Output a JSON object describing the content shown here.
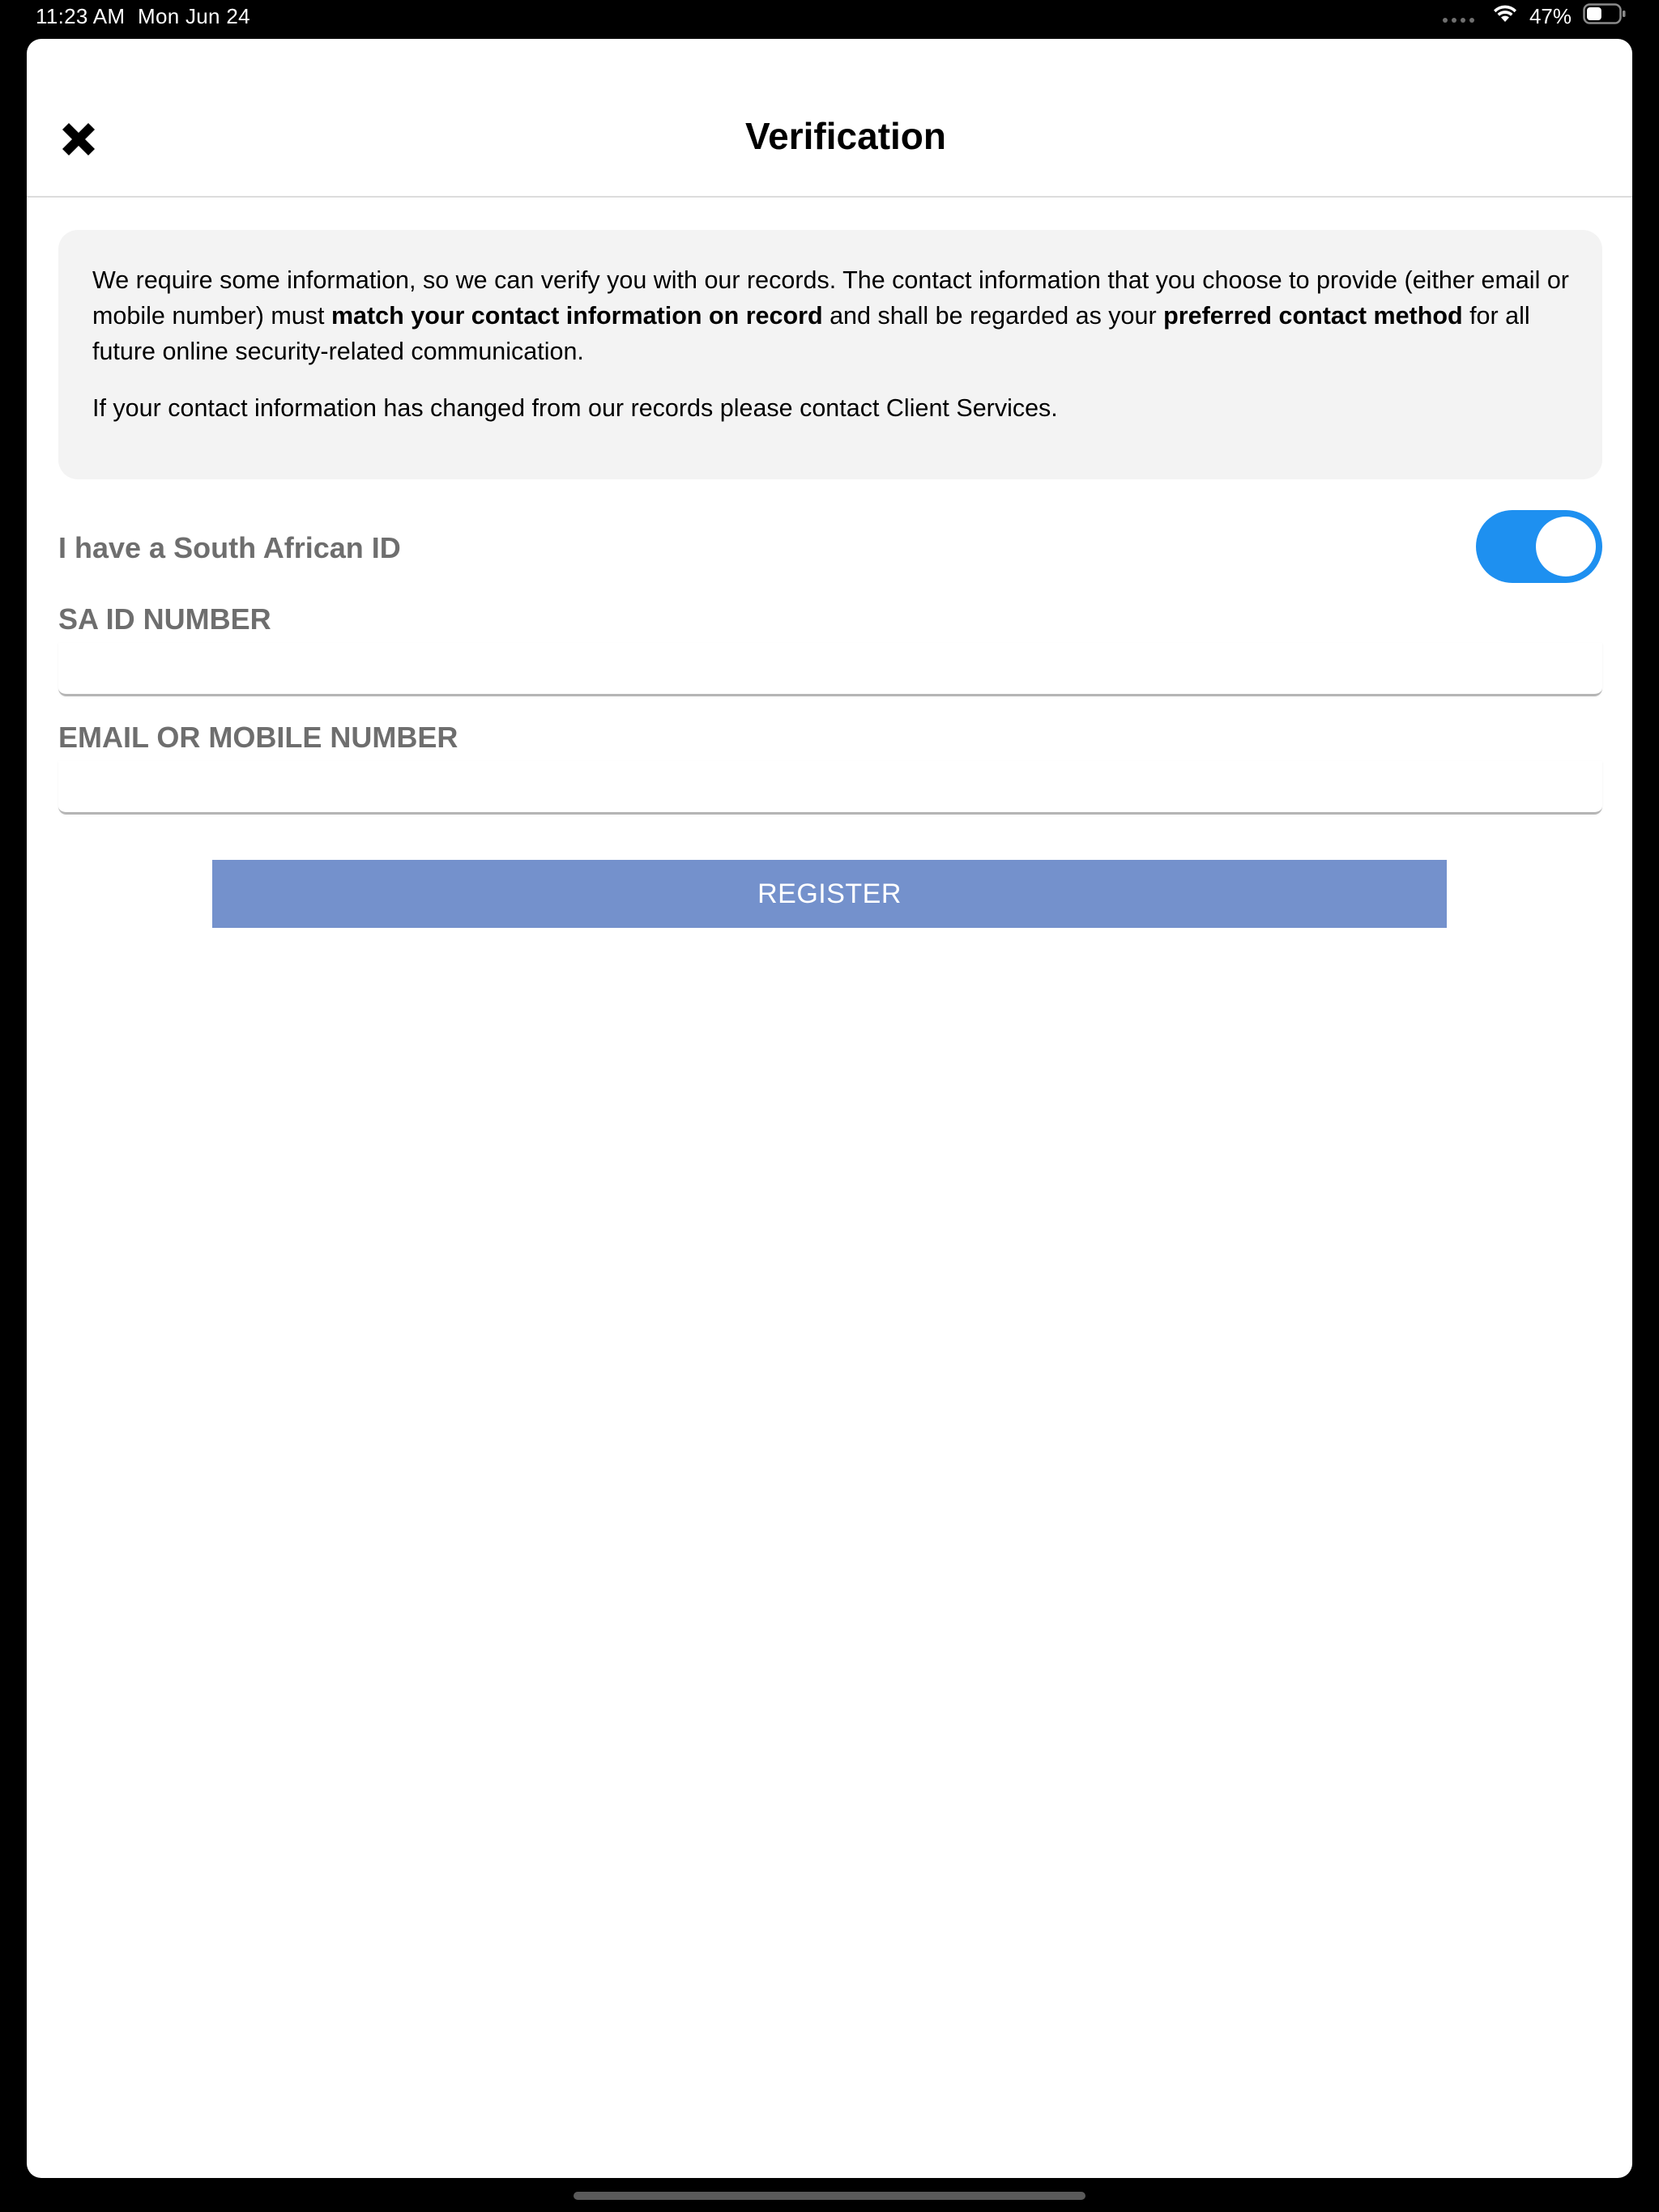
{
  "status_bar": {
    "time": "11:23 AM",
    "date": "Mon Jun 24",
    "battery_percent": "47%",
    "battery_level": 0.47,
    "icons": [
      "dots-icon",
      "wifi-icon",
      "battery-icon"
    ]
  },
  "header": {
    "title": "Verification",
    "close_icon": "close-icon"
  },
  "info": {
    "p1_part1": "We require some information, so we can verify you with our records. The contact information that you choose to provide (either email or mobile number) must ",
    "p1_bold1": "match your contact information on record",
    "p1_part2": " and shall be regarded as your ",
    "p1_bold2": "preferred contact method",
    "p1_part3": " for all future online security-related communication.",
    "p2": "If your contact information has changed from our records please contact Client Services."
  },
  "sa_id_toggle": {
    "label": "I have a South African ID",
    "on": true
  },
  "fields": {
    "sa_id": {
      "label": "SA ID NUMBER",
      "value": "",
      "placeholder": ""
    },
    "contact": {
      "label": "EMAIL OR MOBILE NUMBER",
      "value": "",
      "placeholder": ""
    }
  },
  "register_label": "REGISTER",
  "colors": {
    "toggle_on": "#1e90f0",
    "register_button": "#7491cc",
    "label_gray": "#6e6e6e",
    "info_box_bg": "#f3f3f3"
  }
}
